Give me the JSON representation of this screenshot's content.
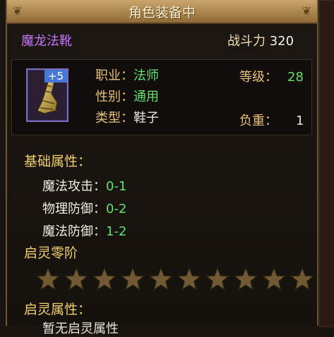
{
  "tooltip": {
    "title": "角色装备中",
    "item_name": "魔龙法靴",
    "power_label": "战斗力",
    "power_value": "320",
    "enhance_level": "+5",
    "job_label": "职业：",
    "job_value": "法师",
    "gender_label": "性别：",
    "gender_value": "通用",
    "type_label": "类型：",
    "type_value": "鞋子",
    "level_label": "等级：",
    "level_value": "28",
    "weight_label": "负重：",
    "weight_value": "1",
    "base_attr_title": "基础属性：",
    "attributes": [
      {
        "label": "魔法攻击：",
        "value": "0-1"
      },
      {
        "label": "物理防御：",
        "value": "0-2"
      },
      {
        "label": "魔法防御：",
        "value": "1-2"
      }
    ],
    "qiling_level": "启灵零阶",
    "stars_total": 10,
    "stars_filled": 0,
    "qiling_attr_title": "启灵属性：",
    "qiling_attr_note": "暂无启灵属性"
  },
  "colors": {
    "item_name": "#c676ff",
    "value_green": "#62e06b",
    "section_gold": "#f0cf6a",
    "enhance_badge": "#4678d8"
  }
}
